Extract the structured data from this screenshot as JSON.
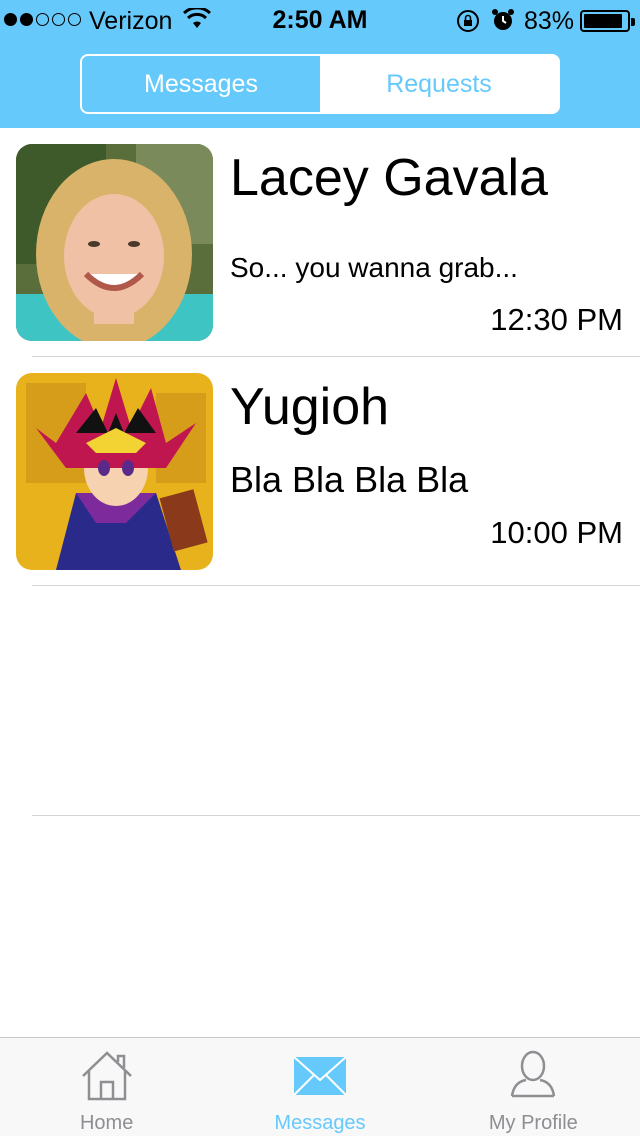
{
  "status_bar": {
    "carrier": "Verizon",
    "time": "2:50 AM",
    "battery": "83%",
    "signal_bars": 2,
    "battery_fraction": 0.83
  },
  "segmented": {
    "active": "Messages",
    "inactive": "Requests"
  },
  "messages": [
    {
      "name": "Lacey Gavala",
      "preview": "So... you wanna grab...",
      "time": "12:30 PM",
      "avatar": "photo-portrait"
    },
    {
      "name": "Yugioh",
      "preview": "Bla Bla Bla Bla",
      "time": "10:00 PM",
      "avatar": "anime-character"
    }
  ],
  "tabbar": {
    "home": "Home",
    "messages": "Messages",
    "profile": "My Profile"
  },
  "colors": {
    "accent": "#66c9fb",
    "tab_inactive": "#8e8e93",
    "separator": "#d4d4d8"
  }
}
